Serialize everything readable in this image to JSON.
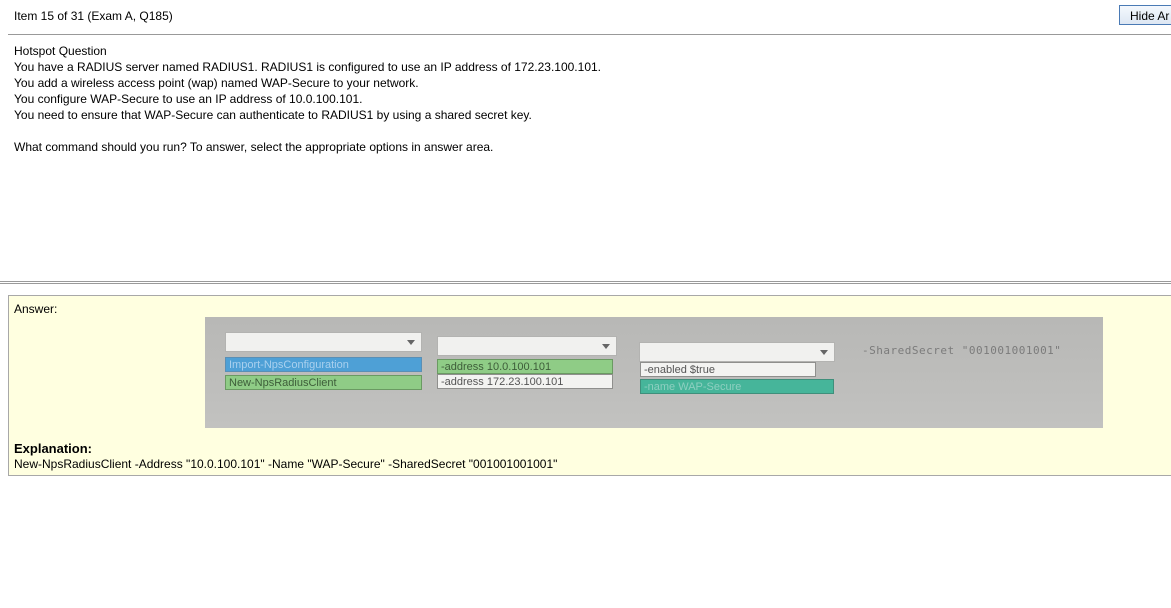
{
  "header": {
    "item_title": "Item 15 of 31  (Exam A, Q185)",
    "hide_button": "Hide Ar"
  },
  "question": {
    "lines": [
      "Hotspot Question",
      "You have a RADIUS server named RADIUS1. RADIUS1 is configured to use an IP address of 172.23.100.101.",
      "You add a wireless access point (wap) named WAP-Secure to your network.",
      "You configure WAP-Secure to use an IP address of 10.0.100.101.",
      "You need to ensure that WAP-Secure can authenticate to RADIUS1 by using a shared secret key."
    ],
    "prompt": "What command should you run? To answer, select the appropriate options in answer area."
  },
  "answer": {
    "label": "Answer:",
    "photo": {
      "dropdown1_options": [
        "Import-NpsConfiguration",
        "New-NpsRadiusClient"
      ],
      "dropdown2_options": [
        "-address 10.0.100.101",
        "-address 172.23.100.101"
      ],
      "dropdown3_options": [
        "-enabled $true",
        "-name WAP-Secure"
      ],
      "shared_secret_text": "-SharedSecret \"001001001001\""
    },
    "explanation_label": "Explanation:",
    "explanation_text": "New-NpsRadiusClient -Address \"10.0.100.101\" -Name \"WAP-Secure\" -SharedSecret \"001001001001\""
  }
}
